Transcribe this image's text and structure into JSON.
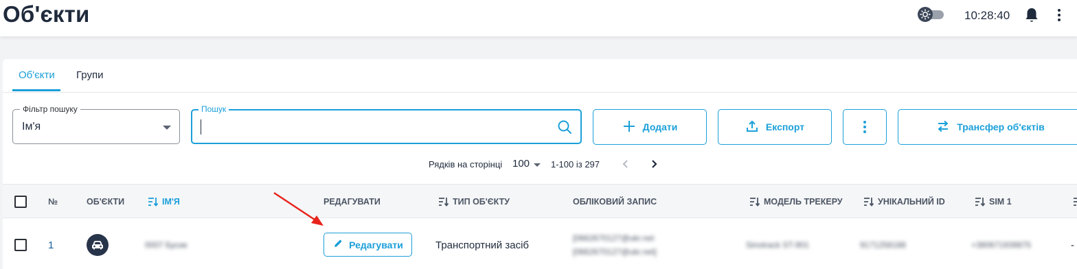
{
  "header": {
    "title": "Об'єкти",
    "clock": "10:28:40"
  },
  "tabs": [
    {
      "label": "Об'єкти",
      "active": true
    },
    {
      "label": "Групи",
      "active": false
    }
  ],
  "filter": {
    "legend": "Фільтр пошуку",
    "value": "Ім'я"
  },
  "search": {
    "legend": "Пошук",
    "value": ""
  },
  "toolbar": {
    "add_label": "Додати",
    "export_label": "Експорт",
    "transfer_label": "Трансфер об'єктів"
  },
  "pagination": {
    "rows_label": "Рядків на сторінці",
    "rows_value": "100",
    "range": "1-100 із 297"
  },
  "table": {
    "columns": [
      "№",
      "ОБ'ЄКТИ",
      "ІМ'Я",
      "РЕДАГУВАТИ",
      "ТИП ОБ'ЄКТУ",
      "ОБЛІКОВИЙ ЗАПИС",
      "МОДЕЛЬ ТРЕКЕРУ",
      "УНІКАЛЬНИЙ ID",
      "SIM 1"
    ],
    "rows": [
      {
        "number": "1",
        "name": "0007 Бусик",
        "edit_label": "Редагувати",
        "type": "Транспортний засіб",
        "account_line1": "[0662670127@ukr.net",
        "account_line2": "[0662670127@ukr.net]",
        "tracker_model": "Sinotrack ST-901",
        "unique_id": "9171258188",
        "sim1": "+380671939875",
        "extra": "-"
      }
    ]
  },
  "colors": {
    "accent": "#1a9fd9",
    "dark": "#1f2a3c",
    "annotation_arrow": "#e8231c"
  }
}
